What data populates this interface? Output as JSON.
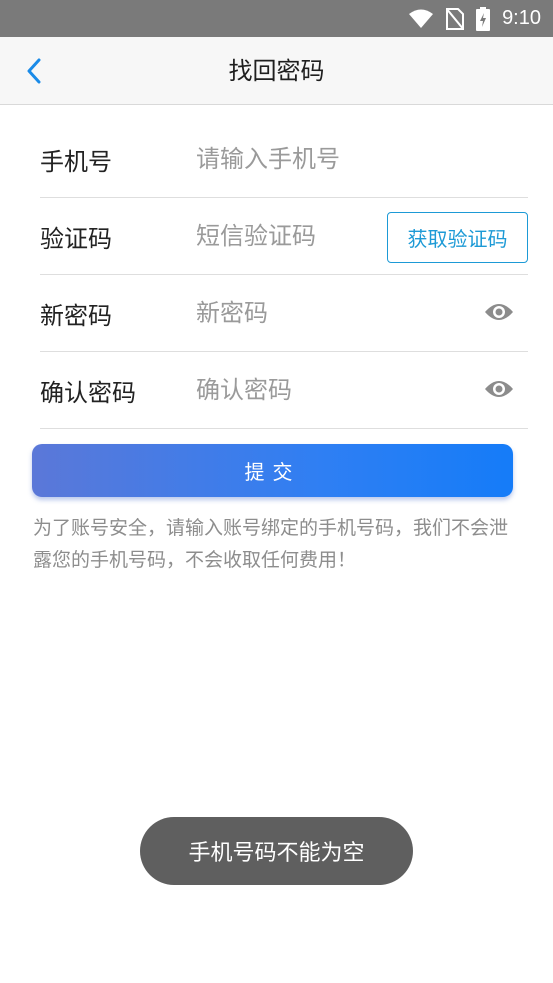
{
  "status_bar": {
    "time": "9:10",
    "icons": [
      "wifi-icon",
      "no-sim-icon",
      "battery-charging-icon"
    ]
  },
  "app_bar": {
    "title": "找回密码",
    "back_icon": "chevron-left-icon"
  },
  "form": {
    "phone": {
      "label": "手机号",
      "placeholder": "请输入手机号"
    },
    "code": {
      "label": "验证码",
      "placeholder": "短信验证码",
      "button_label": "获取验证码"
    },
    "new_password": {
      "label": "新密码",
      "placeholder": "新密码",
      "toggle_icon": "eye-icon"
    },
    "confirm_password": {
      "label": "确认密码",
      "placeholder": "确认密码",
      "toggle_icon": "eye-icon"
    }
  },
  "submit": {
    "label": "提交"
  },
  "notice": "为了账号安全，请输入账号绑定的手机号码，我们不会泄露您的手机号码，不会收取任何费用！",
  "toast": "手机号码不能为空",
  "colors": {
    "accent": "#1d9ad6",
    "button_start": "#5b78d8",
    "button_end": "#157cf8",
    "toast_bg": "#5f5f5f"
  }
}
